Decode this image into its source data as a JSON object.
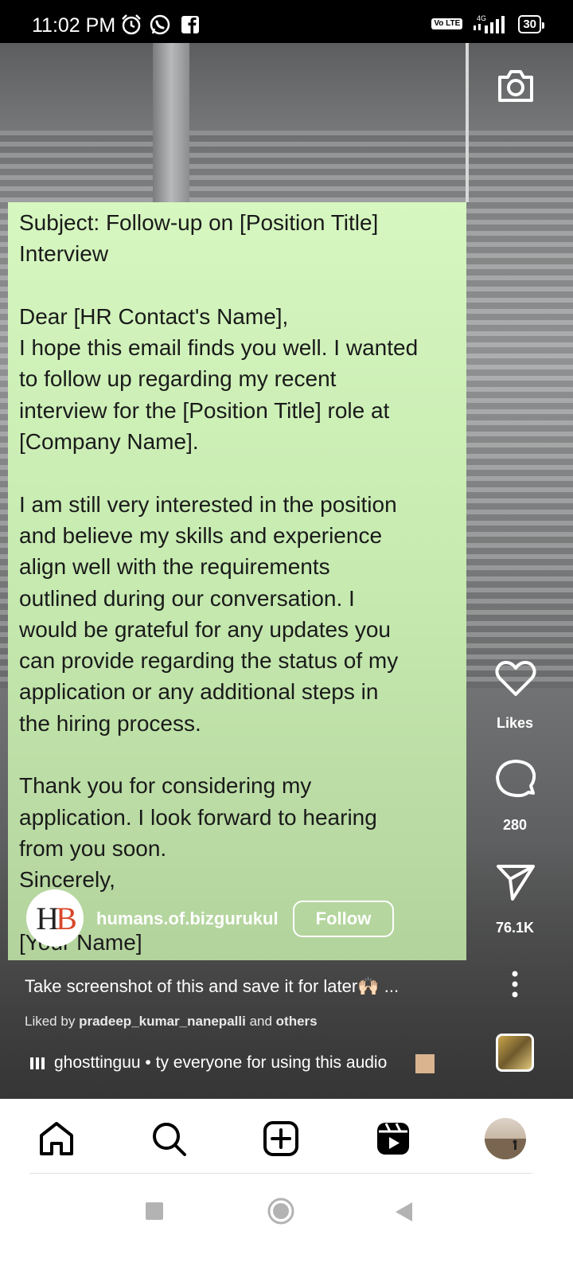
{
  "status_bar": {
    "time": "11:02 PM",
    "icons": [
      "alarm-icon",
      "whatsapp-icon",
      "facebook-icon"
    ],
    "network_badge": "Vo LTE",
    "network_type": "4G",
    "battery": "30"
  },
  "post": {
    "note_text": "Subject: Follow-up on [Position Title]\nInterview\n\nDear [HR Contact's Name],\nI hope this email finds you well. I wanted\nto follow up regarding my recent\ninterview for the [Position Title] role at\n[Company Name].\n\nI am still very interested in the position\nand believe my skills and experience\nalign well with the requirements\noutlined during our conversation. I\nwould be grateful for any updates you\ncan provide regarding the status of my\napplication or any additional steps in\nthe hiring process.\n\nThank you for considering my\napplication. I look forward to hearing\nfrom you soon.\nSincerely,\n\n[Your Name]",
    "author": {
      "avatar_text": "HB",
      "username": "humans.of.bizgurukul",
      "follow_label": "Follow"
    },
    "caption": "Take screenshot of this and save it for later🙌🏻 ...",
    "liked_by": {
      "prefix": "Liked by",
      "user": "pradeep_kumar_nanepalli",
      "and": "and",
      "others": "others"
    },
    "audio": "ghosttinguu • ty everyone for using this audio"
  },
  "actions": {
    "likes_label": "Likes",
    "comments_count": "280",
    "shares_count": "76.1K"
  },
  "bottom_nav": [
    "home-icon",
    "search-icon",
    "create-icon",
    "reels-icon",
    "profile-avatar"
  ],
  "system_nav": [
    "recents-button",
    "home-button",
    "back-button"
  ]
}
